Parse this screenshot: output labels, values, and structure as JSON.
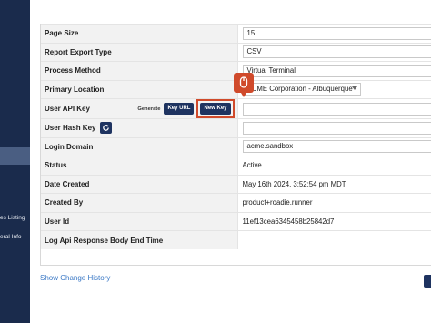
{
  "sidebar": {
    "items": [
      {
        "label": "es Listing"
      },
      {
        "label": "eral Info"
      }
    ]
  },
  "rows": [
    {
      "label": "Page Size",
      "value": "15"
    },
    {
      "label": "Report Export Type",
      "value": "CSV"
    },
    {
      "label": "Process Method",
      "value": "Virtual Terminal"
    },
    {
      "label": "Primary Location",
      "value": "ACME Corporation - Albuquerque"
    },
    {
      "label": "User API Key",
      "value": ""
    },
    {
      "label": "User Hash Key",
      "value": ""
    },
    {
      "label": "Login Domain",
      "value": "acme.sandbox"
    },
    {
      "label": "Status",
      "value": "Active"
    },
    {
      "label": "Date Created",
      "value": "May 16th 2024, 3:52:54 pm MDT"
    },
    {
      "label": "Created By",
      "value": "product+roadie.runner"
    },
    {
      "label": "User Id",
      "value": "11ef13cea6345458b25842d7"
    },
    {
      "label": "Log Api Response Body End Time",
      "value": ""
    }
  ],
  "api_key": {
    "generate_label": "Generate",
    "key_url_label": "Key URL",
    "new_key_label": "New Key"
  },
  "links": {
    "change_history": "Show Change History"
  },
  "colors": {
    "sidebar_bg": "#1a2b4c",
    "button_bg": "#1e3360",
    "highlight": "#d04a2b",
    "link": "#3b79c6"
  }
}
